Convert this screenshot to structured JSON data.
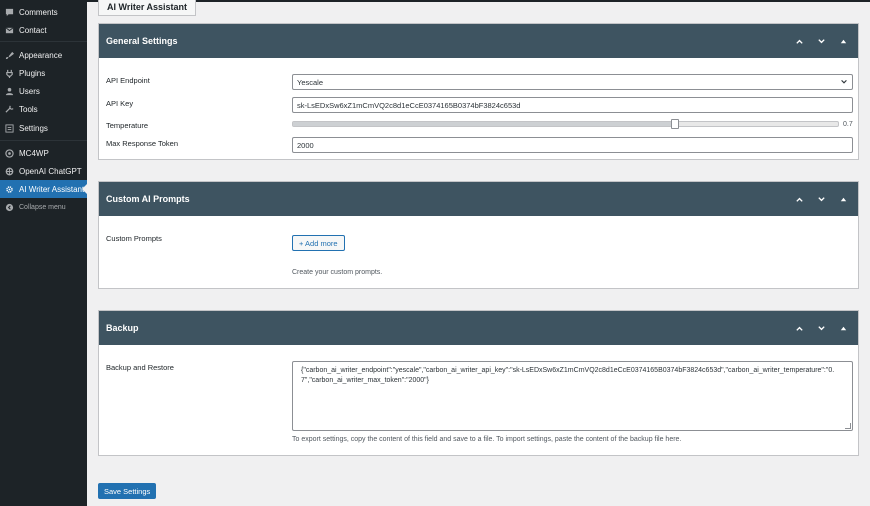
{
  "sidebar": {
    "items": [
      {
        "label": "Comments",
        "icon": "comments-icon"
      },
      {
        "label": "Contact",
        "icon": "mail-icon"
      },
      {
        "label": "Appearance",
        "icon": "paintbrush-icon"
      },
      {
        "label": "Plugins",
        "icon": "plugin-icon"
      },
      {
        "label": "Users",
        "icon": "users-icon"
      },
      {
        "label": "Tools",
        "icon": "wrench-icon"
      },
      {
        "label": "Settings",
        "icon": "settings-icon"
      },
      {
        "label": "MC4WP",
        "icon": "mc4wp-icon"
      },
      {
        "label": "OpenAI ChatGPT",
        "icon": "openai-icon"
      },
      {
        "label": "AI Writer Assistant",
        "icon": "gear-icon",
        "active": true
      },
      {
        "label": "Collapse menu",
        "icon": "collapse-icon"
      }
    ]
  },
  "page": {
    "tab_title": "AI Writer Assistant"
  },
  "general": {
    "title": "General Settings",
    "endpoint_label": "API Endpoint",
    "endpoint_value": "Yescale",
    "key_label": "API Key",
    "key_value": "sk-LsEDxSw6xZ1mCmVQ2c8d1eCcE0374165B0374bF3824c653d",
    "temp_label": "Temperature",
    "temp_value": "0.7",
    "temp_fraction": 0.7,
    "max_label": "Max Response Token",
    "max_value": "2000"
  },
  "prompts": {
    "title": "Custom AI Prompts",
    "label": "Custom Prompts",
    "add_label": "+ Add more",
    "help": "Create your custom prompts."
  },
  "backup": {
    "title": "Backup",
    "label": "Backup and Restore",
    "content": "{\"carbon_ai_writer_endpoint\":\"yescale\",\"carbon_ai_writer_api_key\":\"sk-LsEDxSw6xZ1mCmVQ2c8d1eCcE0374165B0374bF3824c653d\",\"carbon_ai_writer_temperature\":\"0.7\",\"carbon_ai_writer_max_token\":\"2000\"}",
    "help": "To export settings, copy the content of this field and save to a file. To import settings, paste the content of the backup file here."
  },
  "save_label": "Save Settings",
  "colors": {
    "accent": "#2271b1",
    "panel_header": "#3e5461",
    "sidebar": "#1d2327"
  }
}
